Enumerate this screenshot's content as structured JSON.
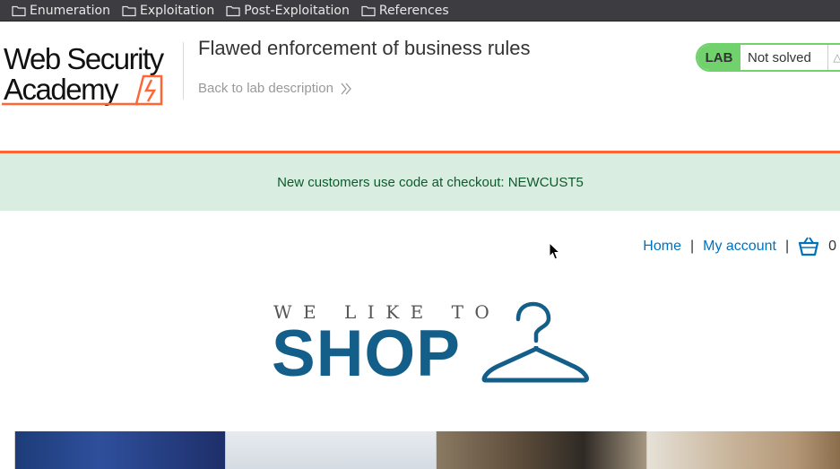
{
  "bookmarks": [
    {
      "label": "Enumeration",
      "icon": "folder-icon"
    },
    {
      "label": "Exploitation",
      "icon": "folder-icon"
    },
    {
      "label": "Post-Exploitation",
      "icon": "folder-icon"
    },
    {
      "label": "References",
      "icon": "folder-icon"
    }
  ],
  "academy": {
    "logo_line1": "Web Security",
    "logo_line2": "Academy",
    "lab_title": "Flawed enforcement of business rules",
    "back_link": "Back to lab description",
    "status_badge": "LAB",
    "status_text": "Not solved"
  },
  "banner": {
    "message": "New customers use code at checkout: NEWCUST5"
  },
  "shop_nav": {
    "home": "Home",
    "separator": "|",
    "my_account": "My account",
    "cart_count": "0"
  },
  "shop_logo": {
    "tagline": "WE LIKE TO",
    "word": "SHOP"
  },
  "colors": {
    "accent_orange": "#ff6633",
    "status_green": "#70d16d",
    "banner_bg": "#d9eee0",
    "brand_blue": "#145e8a",
    "link_blue": "#0071bc"
  }
}
